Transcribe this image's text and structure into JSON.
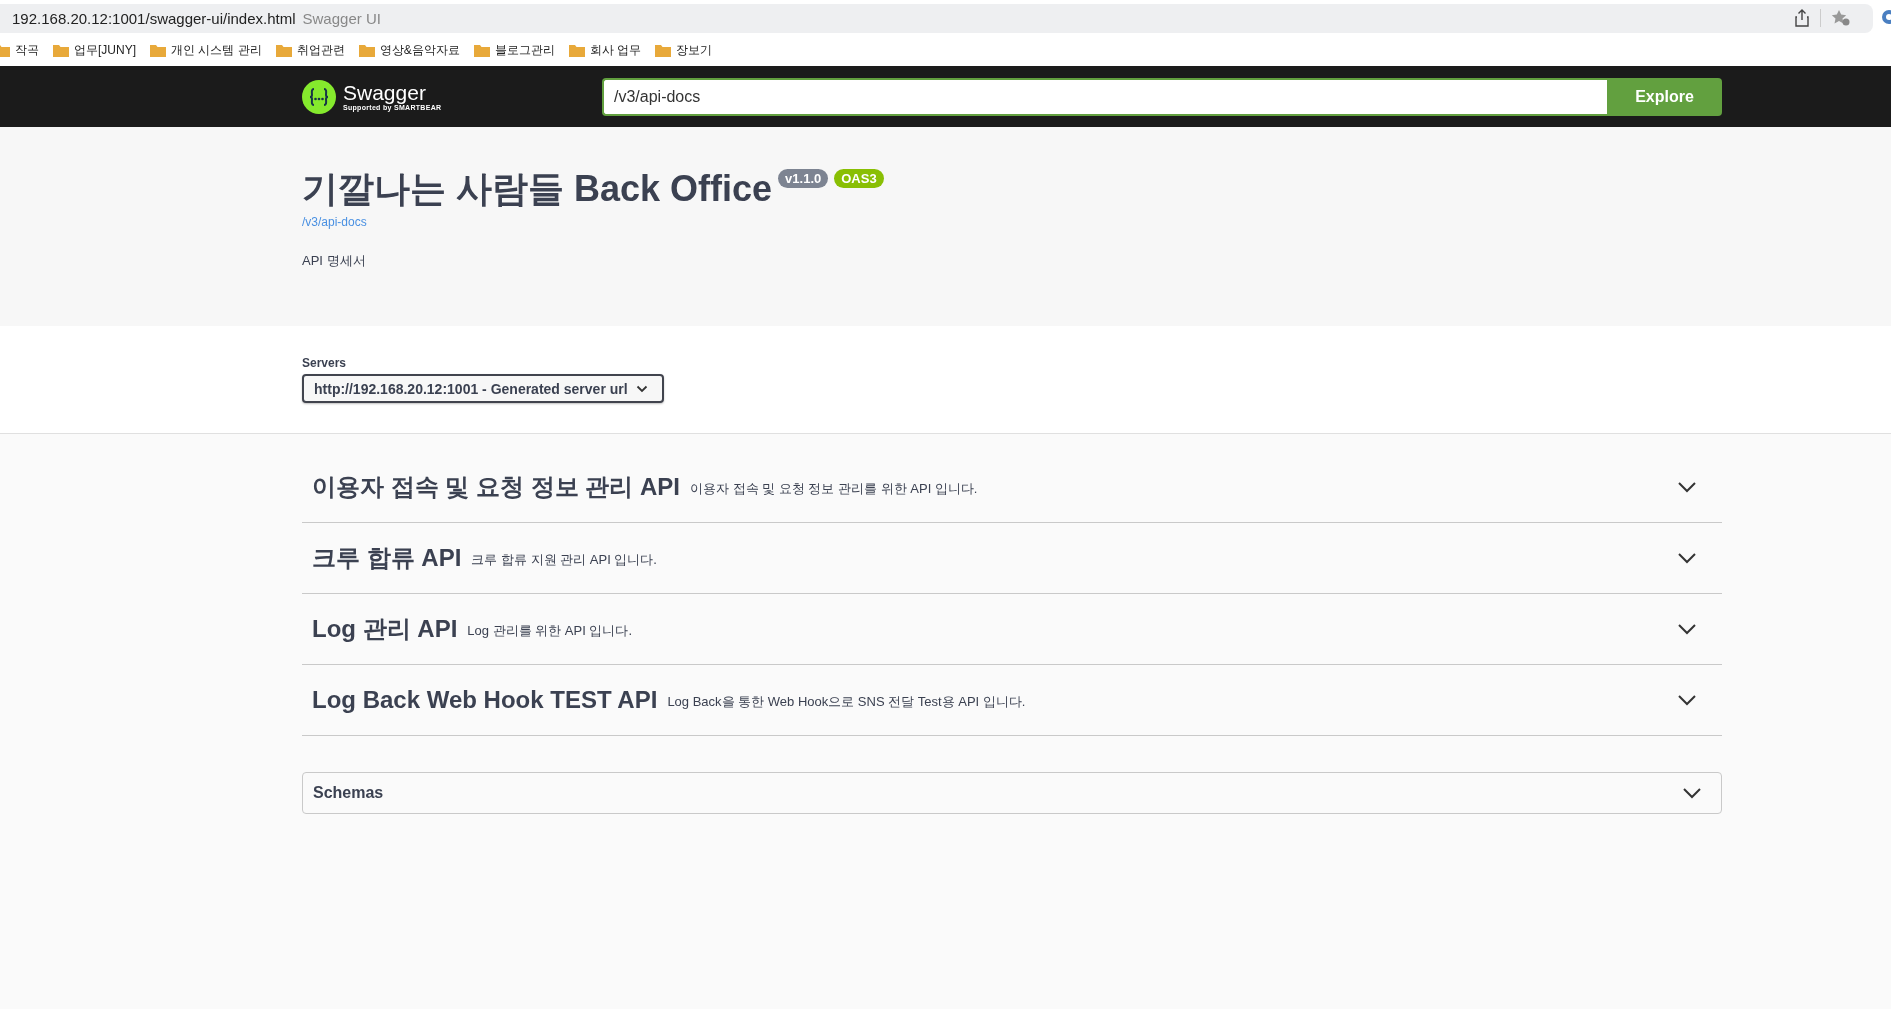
{
  "browser": {
    "url": "192.168.20.12:1001/swagger-ui/index.html",
    "page_title": "Swagger UI"
  },
  "bookmarks": [
    "작곡",
    "업무[JUNY]",
    "개인 시스템 관리",
    "취업관련",
    "영상&음악자료",
    "블로그관리",
    "회사 업무",
    "장보기"
  ],
  "topbar": {
    "logo_text": "Swagger",
    "logo_subtext": "Supported by SMARTBEAR",
    "url_field": "/v3/api-docs",
    "explore_button": "Explore"
  },
  "info": {
    "title": "기깔나는 사람들 Back Office",
    "version": "v1.1.0",
    "spec": "OAS3",
    "docs_link": "/v3/api-docs",
    "description": "API 명세서"
  },
  "servers": {
    "label": "Servers",
    "selected": "http://192.168.20.12:1001 - Generated server url"
  },
  "tags": [
    {
      "name": "이용자 접속 및 요청 정보 관리 API",
      "description": "이용자 접속 및 요청 정보 관리를 위한 API 입니다.",
      "expanded": false
    },
    {
      "name": "크루 합류 API",
      "description": "크루 합류 지원 관리 API 입니다.",
      "expanded": false
    },
    {
      "name": "Log 관리 API",
      "description": "Log 관리를 위한 API 입니다.",
      "expanded": false
    },
    {
      "name": "Log Back Web Hook TEST API",
      "description": "Log Back을 통한 Web Hook으로 SNS 전달 Test용 API 입니다.",
      "expanded": false
    }
  ],
  "schemas": {
    "label": "Schemas",
    "expanded": false
  }
}
